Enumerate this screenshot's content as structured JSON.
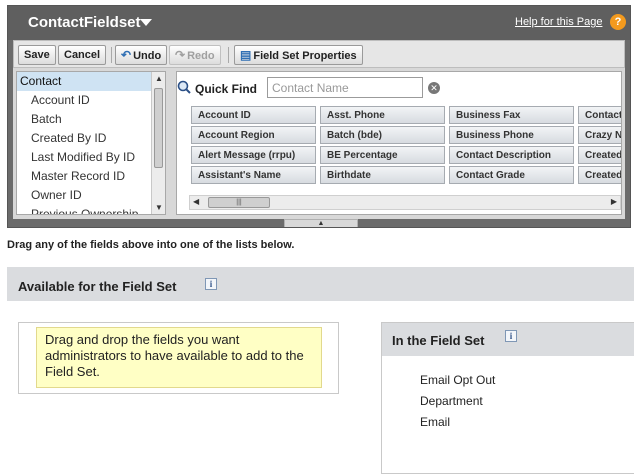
{
  "header": {
    "title": "ContactFieldset",
    "help_link": "Help for this Page",
    "help_icon": "?"
  },
  "toolbar": {
    "save": "Save",
    "cancel": "Cancel",
    "undo": "Undo",
    "redo": "Redo",
    "properties": "Field Set Properties"
  },
  "object_list": [
    "Contact",
    "Account ID",
    "Batch",
    "Created By ID",
    "Last Modified By ID",
    "Master Record ID",
    "Owner ID",
    "Previous Ownership"
  ],
  "quick_find": {
    "label": "Quick Find",
    "placeholder": "Contact Name"
  },
  "fields": [
    [
      "Account ID",
      "Asst. Phone",
      "Business Fax",
      "Contact Currency"
    ],
    [
      "Account Region",
      "Batch (bde)",
      "Business Phone",
      "Crazy Number"
    ],
    [
      "Alert Message (rrpu)",
      "BE Percentage",
      "Contact Description",
      "Created By"
    ],
    [
      "Assistant's Name",
      "Birthdate",
      "Contact Grade",
      "Created Date"
    ]
  ],
  "instructions": "Drag any of the fields above into one of the lists below.",
  "available": {
    "title": "Available for the Field Set",
    "message": "Drag and drop the fields you want administrators to have available to add to the Field Set."
  },
  "in_field_set": {
    "title": "In the Field Set",
    "items": [
      "Email Opt Out",
      "Department",
      "Email"
    ]
  },
  "colors": {
    "header_bg": "#5f5f5f",
    "help_icon": "#f39a1e",
    "selected_item": "#cfe3f3",
    "message_bg": "#ffffc5"
  }
}
